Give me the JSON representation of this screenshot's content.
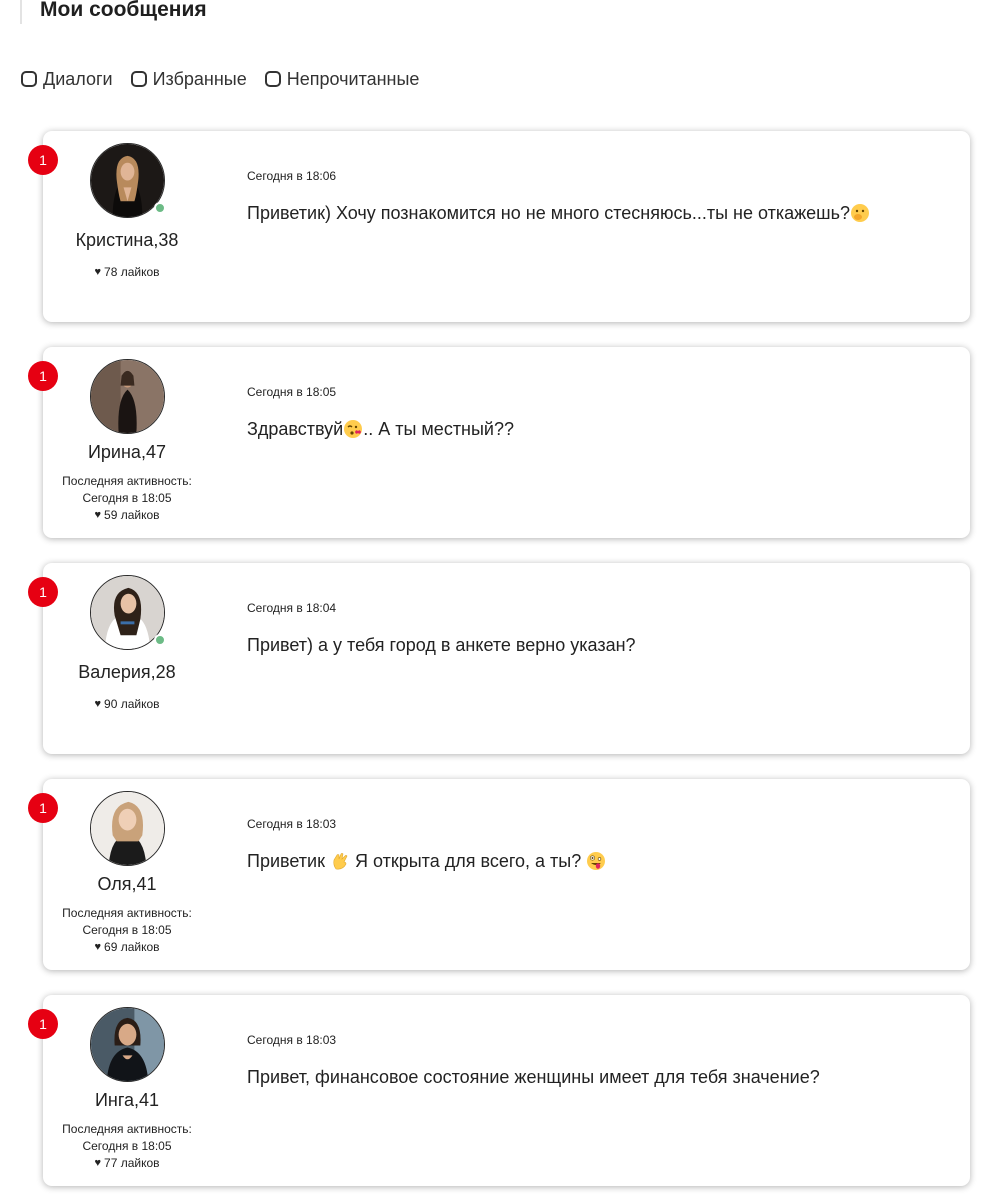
{
  "header": {
    "title": "Мои сообщения"
  },
  "filters": [
    {
      "label": "Диалоги",
      "checked": false
    },
    {
      "label": "Избранные",
      "checked": false
    },
    {
      "label": "Непрочитанные",
      "checked": false
    }
  ],
  "conversations": [
    {
      "badge": "1",
      "name": "Кристина",
      "age": "38",
      "online": true,
      "last_activity_label": "",
      "last_activity_time": "",
      "likes": "78 лайков",
      "timestamp": "Сегодня в 18:06",
      "message": "Приветик) Хочу познакомится но не много стесняюсь...ты не откажешь?",
      "emoji": [
        "face-with-hand-over-mouth"
      ]
    },
    {
      "badge": "1",
      "name": "Ирина",
      "age": "47",
      "online": false,
      "last_activity_label": "Последняя активность:",
      "last_activity_time": "Сегодня в 18:05",
      "likes": "59 лайков",
      "timestamp": "Сегодня в 18:05",
      "message_before": "Здравствуй",
      "message_after": ".. А ты местный??",
      "emoji": [
        "face-blowing-kiss"
      ]
    },
    {
      "badge": "1",
      "name": "Валерия",
      "age": "28",
      "online": true,
      "last_activity_label": "",
      "last_activity_time": "",
      "likes": "90 лайков",
      "timestamp": "Сегодня в 18:04",
      "message": "Привет) а у тебя город в анкете верно указан?",
      "emoji": []
    },
    {
      "badge": "1",
      "name": "Оля",
      "age": "41",
      "online": false,
      "last_activity_label": "Последняя активность:",
      "last_activity_time": "Сегодня в 18:05",
      "likes": "69 лайков",
      "timestamp": "Сегодня в 18:03",
      "message_before": "Приветик",
      "message_after": "Я открыта для всего, а ты?",
      "emoji": [
        "waving-hand",
        "zany-face"
      ]
    },
    {
      "badge": "1",
      "name": "Инга",
      "age": "41",
      "online": false,
      "last_activity_label": "Последняя активность:",
      "last_activity_time": "Сегодня в 18:05",
      "likes": "77 лайков",
      "timestamp": "Сегодня в 18:03",
      "message": "Привет, финансовое состояние женщины имеет для тебя значение?",
      "emoji": []
    }
  ],
  "colors": {
    "badge": "#e60012",
    "online": "#6cbb86",
    "text": "#222222"
  }
}
